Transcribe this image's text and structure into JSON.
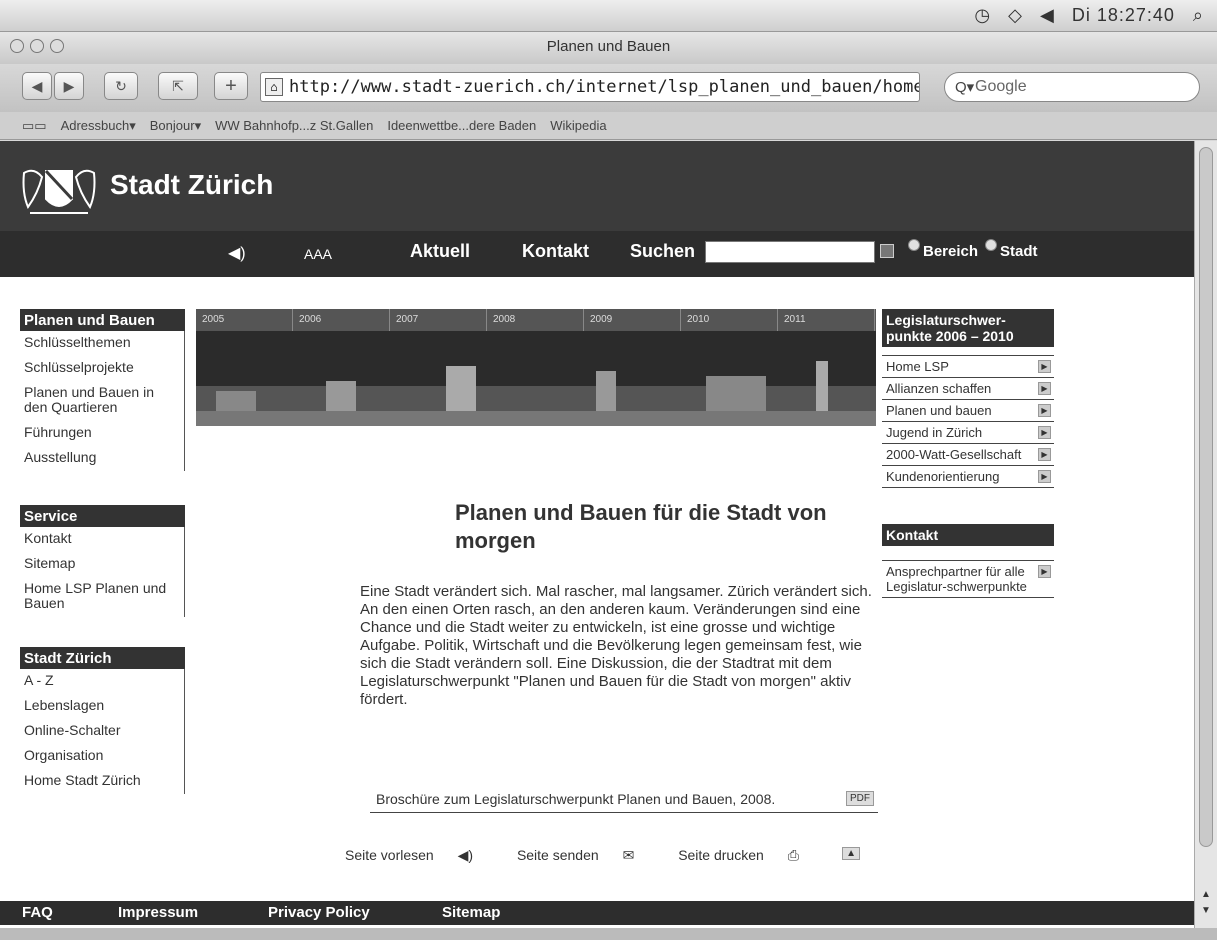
{
  "menubar": {
    "clock": "Di 18:27:40"
  },
  "window": {
    "title": "Planen und Bauen"
  },
  "toolbar": {
    "url": "http://www.stadt-zuerich.ch/internet/lsp_planen_und_bauen/home.html",
    "search_placeholder": "Google"
  },
  "bookmarks": [
    "Adressbuch▾",
    "Bonjour▾",
    "WW Bahnhofp...z St.Gallen",
    "Ideenwettbe...dere Baden",
    "Wikipedia"
  ],
  "site": {
    "title": "Stadt Zürich"
  },
  "topnav": {
    "size": "AAA",
    "aktuell": "Aktuell",
    "kontakt": "Kontakt",
    "suchen": "Suchen",
    "bereich": "Bereich",
    "stadt": "Stadt"
  },
  "left": {
    "planen": {
      "title": "Planen und Bauen",
      "items": [
        "Schlüsselthemen",
        "Schlüsselprojekte",
        "Planen und Bauen in den Quartieren",
        "Führungen",
        "Ausstellung"
      ]
    },
    "service": {
      "title": "Service",
      "items": [
        "Kontakt",
        "Sitemap",
        "Home LSP Planen und Bauen"
      ]
    },
    "stadt": {
      "title": "Stadt Zürich",
      "items": [
        "A - Z",
        "Lebenslagen",
        "Online-Schalter",
        "Organisation",
        "Home Stadt Zürich"
      ]
    }
  },
  "banner": {
    "years": [
      "2005",
      "2006",
      "2007",
      "2008",
      "2009",
      "2010",
      "2011"
    ]
  },
  "main": {
    "heading": "Planen und Bauen für die Stadt von morgen",
    "text": "Eine Stadt verändert sich. Mal rascher, mal langsamer. Zürich verändert sich. An den einen Orten rasch, an den anderen kaum. Veränderungen sind eine Chance und die Stadt weiter zu entwickeln, ist eine grosse und wichtige Aufgabe. Politik, Wirtschaft und die Bevölkerung legen gemeinsam fest, wie sich die Stadt verändern soll. Eine Diskussion, die der Stadtrat mit dem Legislaturschwerpunkt \"Planen und Bauen für die Stadt von morgen\" aktiv fördert.",
    "brochure": "Broschüre zum Legislaturschwerpunkt Planen und Bauen, 2008.",
    "pdf": "PDF",
    "tools": {
      "read": "Seite vorlesen",
      "send": "Seite senden",
      "print": "Seite drucken"
    }
  },
  "right": {
    "legis": {
      "title": "Legislaturschwer-punkte 2006 – 2010",
      "items": [
        "Home LSP",
        "Allianzen schaffen",
        "Planen und bauen",
        "Jugend in Zürich",
        "2000-Watt-Gesellschaft",
        "Kundenorientierung"
      ]
    },
    "kontakt": {
      "title": "Kontakt",
      "items": [
        "Ansprechpartner für alle Legislatur-schwerpunkte"
      ]
    }
  },
  "footer": {
    "faq": "FAQ",
    "impressum": "Impressum",
    "privacy": "Privacy Policy",
    "sitemap": "Sitemap"
  }
}
